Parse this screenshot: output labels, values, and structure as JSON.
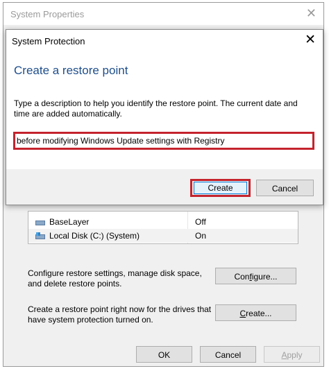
{
  "parent": {
    "title": "System Properties",
    "close_glyph": "✕",
    "drives": [
      {
        "name": "BaseLayer",
        "status": "Off"
      },
      {
        "name": "Local Disk (C:) (System)",
        "status": "On"
      }
    ],
    "configure_desc": "Configure restore settings, manage disk space, and delete restore points.",
    "configure_pre": "Con",
    "configure_ul": "f",
    "configure_post": "igure...",
    "create_desc": "Create a restore point right now for the drives that have system protection turned on.",
    "create_ul": "C",
    "create_post": "reate...",
    "ok_label": "OK",
    "cancel_label": "Cancel",
    "apply_ul": "A",
    "apply_post": "pply"
  },
  "dialog": {
    "title": "System Protection",
    "close_glyph": "✕",
    "heading": "Create a restore point",
    "instructions": "Type a description to help you identify the restore point. The current date and time are added automatically.",
    "input_value": "before modifying Windows Update settings with Registry",
    "create_label": "Create",
    "cancel_label": "Cancel"
  },
  "icons": [
    "drive-icon",
    "system-drive-icon",
    "close-icon"
  ],
  "colors": {
    "highlight_border": "#c4232d",
    "heading": "#1e4e8c",
    "focus_border": "#0078d7"
  }
}
